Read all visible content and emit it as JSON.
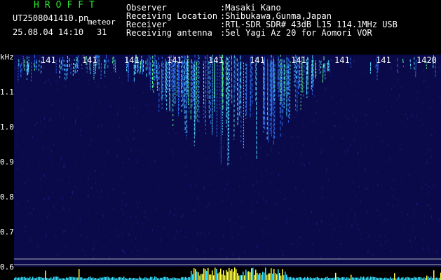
{
  "header": {
    "brand": "HROFFT",
    "filename": "UT2508041410.pn",
    "meteor_label": "meteor",
    "datetime": "25.08.04 14:10",
    "count": "31",
    "observer_label": "Observer",
    "observer_value": ":Masaki Kano",
    "location_label": "Receiving Location",
    "location_value": ":Shibukawa,Gunma,Japan",
    "receiver_label": "Receiver",
    "receiver_value": ":RTL-SDR SDR# 43dB L15 114.1MHz USB",
    "antenna_label": "Receiving antenna",
    "antenna_value": ":5el Yagi Az 20 for Aomori VOR"
  },
  "axes": {
    "y_unit": "kHz",
    "y_labels": [
      "1.1",
      "1.0",
      "0.9",
      "0.8",
      "0.7",
      "0.6"
    ],
    "x_labels": [
      "141",
      "141",
      "141",
      "141",
      "141",
      "141",
      "141",
      "141",
      "141",
      "1420"
    ]
  },
  "colors": {
    "background": "#000000",
    "spectrum_bg": "#0a0a4a",
    "trace_blue": "#2a6cf0",
    "trace_cyan": "#4fd8ff",
    "trace_green": "#5cff8a",
    "activity_yellow": "#ffff40",
    "activity_cyan": "#30e0ff",
    "brand_green": "#2ee82e"
  }
}
